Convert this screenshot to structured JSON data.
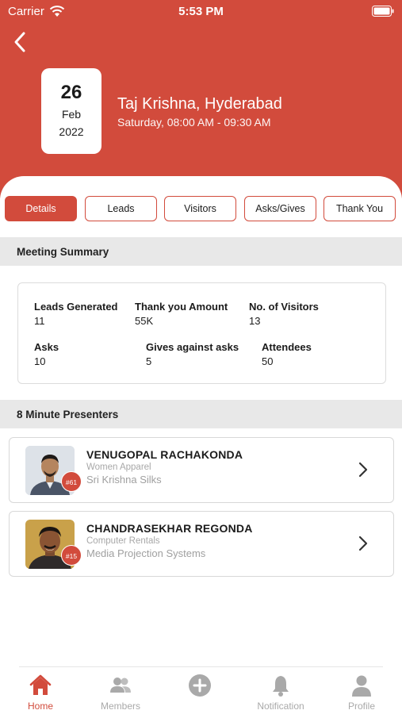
{
  "status_bar": {
    "carrier": "Carrier",
    "time": "5:53 PM"
  },
  "meeting": {
    "day": "26",
    "month": "Feb",
    "year": "2022",
    "venue": "Taj Krishna, Hyderabad",
    "schedule": "Saturday, 08:00 AM - 09:30 AM"
  },
  "tabs": [
    {
      "label": "Details",
      "active": true
    },
    {
      "label": "Leads"
    },
    {
      "label": "Visitors"
    },
    {
      "label": "Asks/Gives"
    },
    {
      "label": "Thank You"
    }
  ],
  "summary": {
    "title": "Meeting Summary",
    "stats": [
      {
        "label": "Leads Generated",
        "value": "11"
      },
      {
        "label": "Thank you Amount",
        "value": "55K"
      },
      {
        "label": "No. of Visitors",
        "value": "13"
      },
      {
        "label": "Asks",
        "value": "10"
      },
      {
        "label": "Gives against asks",
        "value": "5"
      },
      {
        "label": "Attendees",
        "value": "50"
      }
    ]
  },
  "presenters": {
    "title": "8 Minute Presenters",
    "items": [
      {
        "name": "VENUGOPAL RACHAKONDA",
        "category": "Women Apparel",
        "company": "Sri Krishna Silks",
        "badge": "#61"
      },
      {
        "name": "CHANDRASEKHAR REGONDA",
        "category": "Computer Rentals",
        "company": "Media Projection Systems",
        "badge": "#15"
      }
    ]
  },
  "bottom_nav": [
    {
      "label": "Home",
      "icon": "home-icon",
      "active": true
    },
    {
      "label": "Members",
      "icon": "members-icon"
    },
    {
      "label": "",
      "icon": "add-icon"
    },
    {
      "label": "Notification",
      "icon": "bell-icon"
    },
    {
      "label": "Profile",
      "icon": "profile-icon"
    }
  ],
  "colors": {
    "accent": "#d24b3c",
    "section_band": "#e8e8e8",
    "inactive_nav": "#a9a9a9"
  }
}
